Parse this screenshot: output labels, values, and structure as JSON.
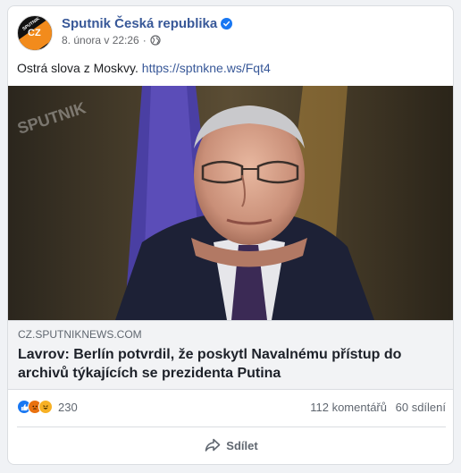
{
  "post": {
    "page_name": "Sputnik Česká republika",
    "avatar_text": "CZ",
    "avatar_small": "SPUTNIK",
    "date": "8. února v 22:26",
    "separator": "·",
    "text": "Ostrá slova z Moskvy.",
    "link": "https://sptnkne.ws/Fqt4"
  },
  "link_preview": {
    "watermark": "SPUTNIK",
    "domain": "cz.sputniknews.com",
    "headline": "Lavrov: Berlín potvrdil, že poskytl Navalnému přístup do archivů týkajících se prezidenta Putina"
  },
  "stats": {
    "reactions": [
      "like-icon",
      "angry-icon",
      "haha-icon"
    ],
    "reaction_count": "230",
    "comments": "112 komentářů",
    "shares": "60 sdílení"
  },
  "actions": {
    "share_label": "Sdílet"
  },
  "colors": {
    "link": "#385898",
    "verified": "#1877f2",
    "brand_orange": "#f28b1c"
  }
}
